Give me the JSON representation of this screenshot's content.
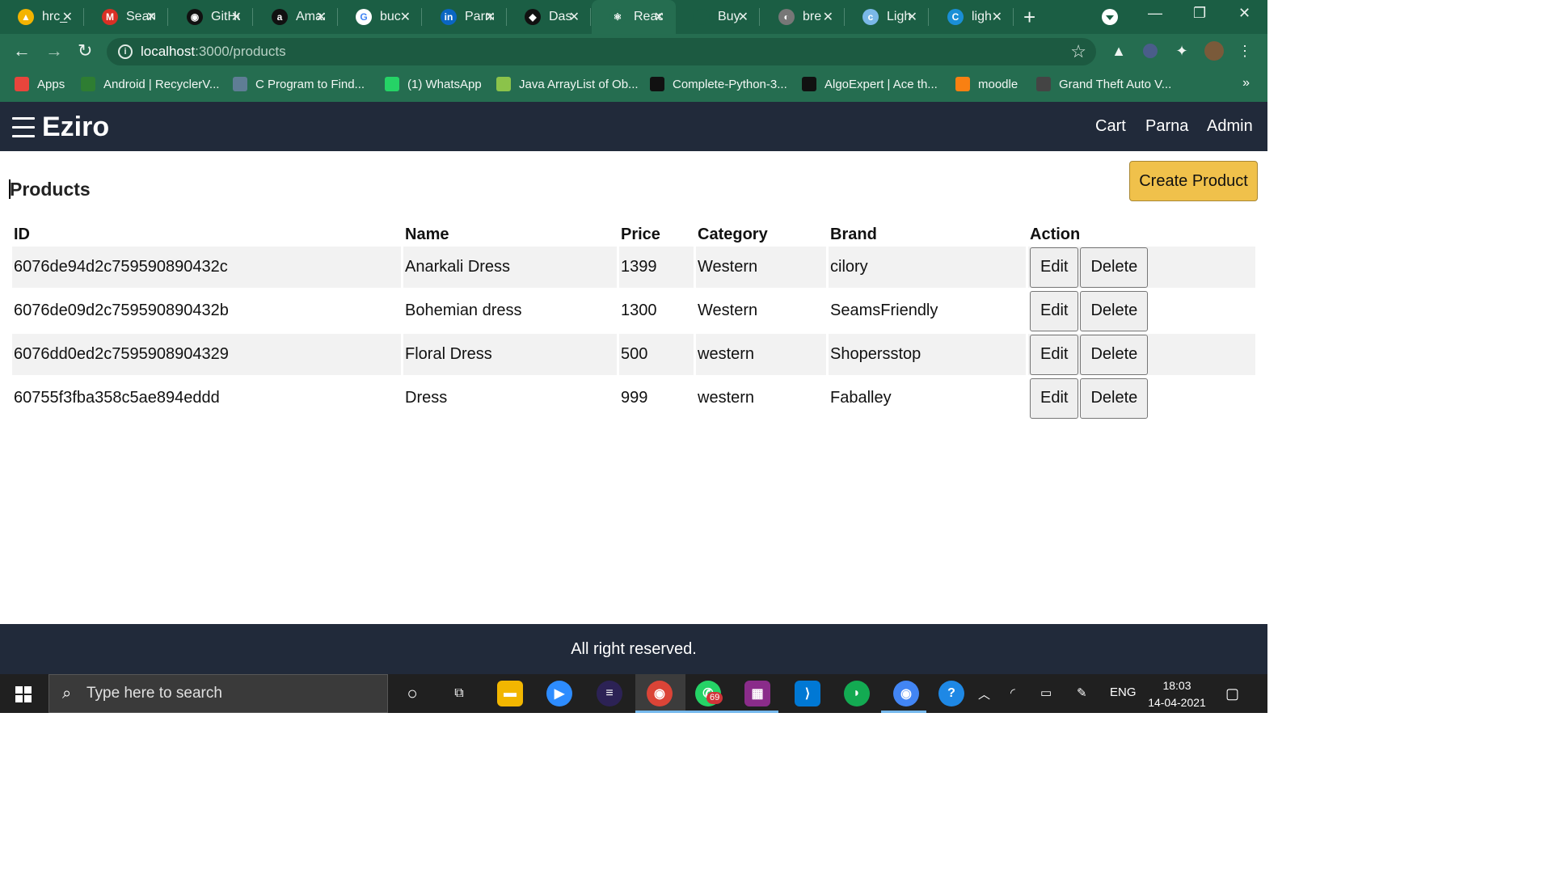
{
  "browser": {
    "tabs": [
      {
        "title": "hrc_",
        "fav_color": "#f4b400",
        "fav_glyph": "▲",
        "active": false
      },
      {
        "title": "Search",
        "fav_color": "#d93025",
        "fav_glyph": "M",
        "active": false
      },
      {
        "title": "GitHub",
        "fav_color": "#111111",
        "fav_glyph": "◉",
        "active": false
      },
      {
        "title": "Amazon",
        "fav_color": "#111111",
        "fav_glyph": "a",
        "active": false
      },
      {
        "title": "buc",
        "fav_color": "#ffffff",
        "fav_glyph": "G",
        "active": false
      },
      {
        "title": "Parna",
        "fav_color": "#0a66c2",
        "fav_glyph": "in",
        "active": false
      },
      {
        "title": "Das",
        "fav_color": "#111111",
        "fav_glyph": "◆",
        "active": false
      },
      {
        "title": "React",
        "fav_color": "#256d50",
        "fav_glyph": "⚛",
        "active": true
      },
      {
        "title": "Buy",
        "fav_color": "#1b5e44",
        "fav_glyph": "",
        "active": false
      },
      {
        "title": "bre",
        "fav_color": "#777777",
        "fav_glyph": "◐",
        "active": false
      },
      {
        "title": "Ligh",
        "fav_color": "#7ab8e8",
        "fav_glyph": "c",
        "active": false
      },
      {
        "title": "ligh",
        "fav_color": "#1a8fd6",
        "fav_glyph": "C",
        "active": false
      }
    ],
    "url_host": "localhost",
    "url_path": ":3000/products",
    "bookmarks": [
      {
        "label": "Apps",
        "icon_color": "#e8453c"
      },
      {
        "label": "Android | RecyclerV...",
        "icon_color": "#2e7d32"
      },
      {
        "label": "C Program to Find...",
        "icon_color": "#5f7d95"
      },
      {
        "label": "(1) WhatsApp",
        "icon_color": "#25d366"
      },
      {
        "label": "Java ArrayList of Ob...",
        "icon_color": "#8bc34a"
      },
      {
        "label": "Complete-Python-3...",
        "icon_color": "#111111"
      },
      {
        "label": "AlgoExpert | Ace th...",
        "icon_color": "#111111"
      },
      {
        "label": "moodle",
        "icon_color": "#f98012"
      },
      {
        "label": "Grand Theft Auto V...",
        "icon_color": "#444444"
      }
    ]
  },
  "app": {
    "brand": "Eziro",
    "nav": {
      "cart": "Cart",
      "user": "Parna",
      "admin": "Admin"
    },
    "page_title": "Products",
    "create_button": "Create Product",
    "columns": [
      "ID",
      "Name",
      "Price",
      "Category",
      "Brand",
      "Action"
    ],
    "rows": [
      {
        "id": "6076de94d2c759590890432c",
        "name": "Anarkali Dress",
        "price": "1399",
        "category": "Western",
        "brand": "cilory"
      },
      {
        "id": "6076de09d2c759590890432b",
        "name": "Bohemian dress",
        "price": "1300",
        "category": "Western",
        "brand": "SeamsFriendly"
      },
      {
        "id": "6076dd0ed2c7595908904329",
        "name": "Floral Dress",
        "price": "500",
        "category": "western",
        "brand": "Shopersstop"
      },
      {
        "id": "60755f3fba358c5ae894eddd",
        "name": "Dress",
        "price": "999",
        "category": "western",
        "brand": "Faballey"
      }
    ],
    "edit_label": "Edit",
    "delete_label": "Delete",
    "footer": "All right reserved."
  },
  "taskbar": {
    "search_placeholder": "Type here to search",
    "whatsapp_badge": "69",
    "language": "ENG",
    "time": "18:03",
    "date": "14-04-2021"
  }
}
